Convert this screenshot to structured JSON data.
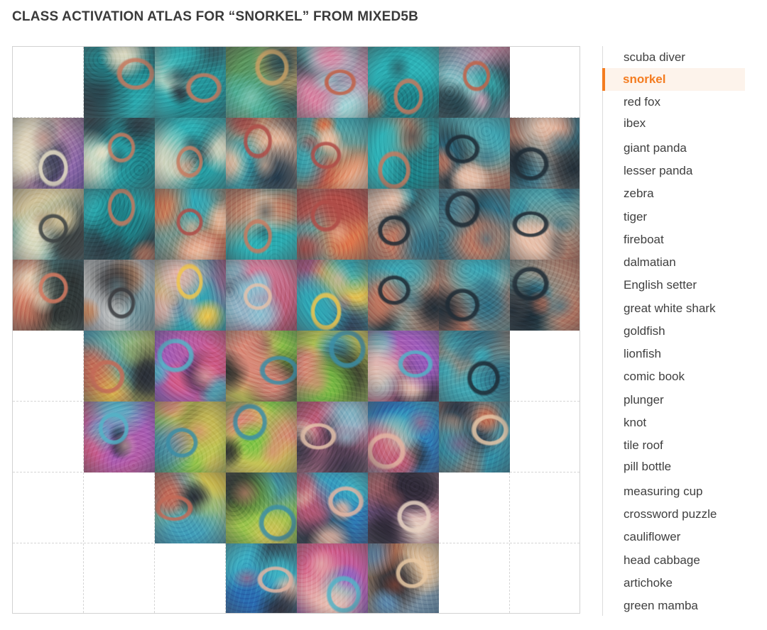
{
  "title": "CLASS ACTIVATION ATLAS FOR “SNORKEL” FROM MIXED5B",
  "accent_color": "#f47c20",
  "selected_class": "snorkel",
  "classes": [
    "scuba diver",
    "snorkel",
    "red fox",
    "ibex",
    "giant panda",
    "lesser panda",
    "zebra",
    "tiger",
    "fireboat",
    "dalmatian",
    "English setter",
    "great white shark",
    "goldfish",
    "lionfish",
    "comic book",
    "plunger",
    "knot",
    "tile roof",
    "pill bottle",
    "measuring cup",
    "crossword puzzle",
    "cauliflower",
    "head cabbage",
    "artichoke",
    "green mamba"
  ],
  "atlas": {
    "columns": 8,
    "rows": 8,
    "cell_rows": [
      {
        "cols": [
          1,
          2,
          3,
          4,
          5,
          6
        ],
        "themes": [
          "teal-ripples",
          "teal-ripples",
          "teal-green",
          "teal-pink",
          "teal-ripples",
          "teal-pink"
        ]
      },
      {
        "cols": [
          0,
          1,
          2,
          3,
          4,
          5,
          6,
          7
        ],
        "themes": [
          "sand-purple",
          "teal-ripples",
          "teal-ripples",
          "teal-orange",
          "teal-orange",
          "teal-ripples",
          "teal-bubbles",
          "teal-bubbles"
        ]
      },
      {
        "cols": [
          0,
          1,
          2,
          3,
          4,
          5,
          6,
          7
        ],
        "themes": [
          "sand-teal",
          "teal-ripples",
          "teal-orange",
          "teal-ripples",
          "teal-orange",
          "teal-bubbles",
          "teal-bubbles",
          "teal-bubbles"
        ]
      },
      {
        "cols": [
          0,
          1,
          2,
          3,
          4,
          5,
          6,
          7
        ],
        "themes": [
          "sand-coral",
          "coral-white",
          "teal-mask",
          "mask-pink",
          "teal-mask",
          "teal-bubbles",
          "teal-bubbles",
          "teal-bubbles"
        ]
      },
      {
        "cols": [
          1,
          2,
          3,
          4,
          5,
          6
        ],
        "themes": [
          "mask-yellow",
          "mask-purple",
          "mask-green",
          "mask-green",
          "mask-purple",
          "teal-bubbles"
        ]
      },
      {
        "cols": [
          1,
          2,
          3,
          4,
          5,
          6
        ],
        "themes": [
          "mask-purple",
          "mask-green",
          "mask-green",
          "mask-pink",
          "mask-teal",
          "teal-worm"
        ]
      },
      {
        "cols": [
          2,
          3,
          4,
          5
        ],
        "themes": [
          "mask-yellow",
          "mask-green",
          "mask-teal",
          "worm-pink"
        ]
      },
      {
        "cols": [
          3,
          4,
          5
        ],
        "themes": [
          "mask-teal",
          "mask-purple",
          "worm-orange"
        ]
      }
    ]
  }
}
